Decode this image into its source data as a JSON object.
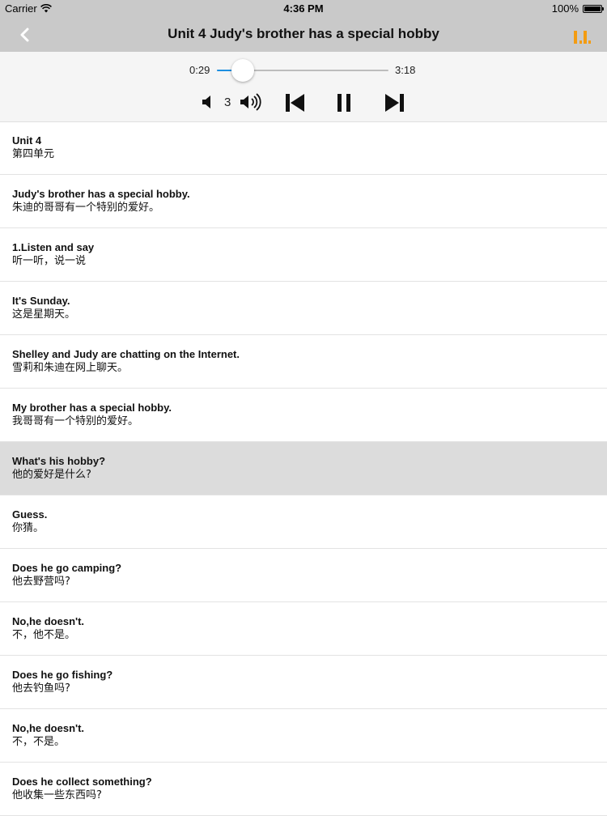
{
  "status": {
    "carrier": "Carrier",
    "time": "4:36 PM",
    "battery": "100%"
  },
  "nav": {
    "title": "Unit 4 Judy's brother has a special hobby",
    "accent": "#f39c12"
  },
  "player": {
    "current_time": "0:29",
    "total_time": "3:18",
    "progress": 0.15,
    "volume": "3",
    "track_color": "#1d8fe1"
  },
  "sentences": [
    {
      "en": "Unit 4",
      "zh": "第四单元"
    },
    {
      "en": "Judy's brother has a special hobby.",
      "zh": "朱迪的哥哥有一个特别的爱好。"
    },
    {
      "en": "1.Listen and say",
      "zh": "听一听，说一说"
    },
    {
      "en": "It's Sunday.",
      "zh": "这是星期天。"
    },
    {
      "en": "Shelley and Judy are chatting on the Internet.",
      "zh": "雪莉和朱迪在网上聊天。"
    },
    {
      "en": "My brother has a special hobby.",
      "zh": "我哥哥有一个特别的爱好。"
    },
    {
      "en": "What's his hobby?",
      "zh": "他的爱好是什么?"
    },
    {
      "en": "Guess.",
      "zh": "你猜。"
    },
    {
      "en": "Does he go camping?",
      "zh": "他去野营吗?"
    },
    {
      "en": "No,he doesn't.",
      "zh": "不，他不是。"
    },
    {
      "en": "Does he go fishing?",
      "zh": "他去钓鱼吗?"
    },
    {
      "en": "No,he doesn't.",
      "zh": "不，不是。"
    },
    {
      "en": "Does he collect something?",
      "zh": "他收集一些东西吗?"
    }
  ],
  "active_index": 6
}
